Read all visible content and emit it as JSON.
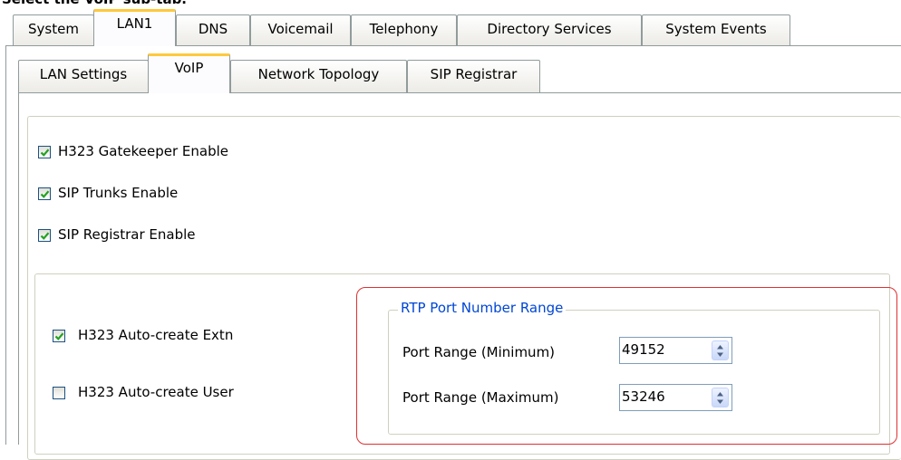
{
  "caption": "Select the VoIP sub-tab.",
  "main_tabs": [
    {
      "label": "System"
    },
    {
      "label": "LAN1",
      "active": true
    },
    {
      "label": "DNS"
    },
    {
      "label": "Voicemail"
    },
    {
      "label": "Telephony"
    },
    {
      "label": "Directory Services"
    },
    {
      "label": "System Events"
    }
  ],
  "sub_tabs": [
    {
      "label": "LAN Settings"
    },
    {
      "label": "VoIP",
      "active": true
    },
    {
      "label": "Network Topology"
    },
    {
      "label": "SIP Registrar"
    }
  ],
  "voip": {
    "h323_gatekeeper": {
      "label": "H323 Gatekeeper Enable",
      "checked": true
    },
    "sip_trunks": {
      "label": "SIP Trunks Enable",
      "checked": true
    },
    "sip_registrar": {
      "label": "SIP Registrar Enable",
      "checked": true
    },
    "auto_create_extn": {
      "label": "H323 Auto-create Extn",
      "checked": true
    },
    "auto_create_user": {
      "label": "H323 Auto-create User",
      "checked": false
    }
  },
  "rtp": {
    "title": "RTP Port Number Range",
    "min_label": "Port Range (Minimum)",
    "min_value": "49152",
    "max_label": "Port Range (Maximum)",
    "max_value": "53246"
  },
  "colors": {
    "active_tab_accent": "#ffc83c",
    "group_title": "#0046d5",
    "highlight_outline": "#e03030",
    "checkbox_check": "#21a121"
  }
}
